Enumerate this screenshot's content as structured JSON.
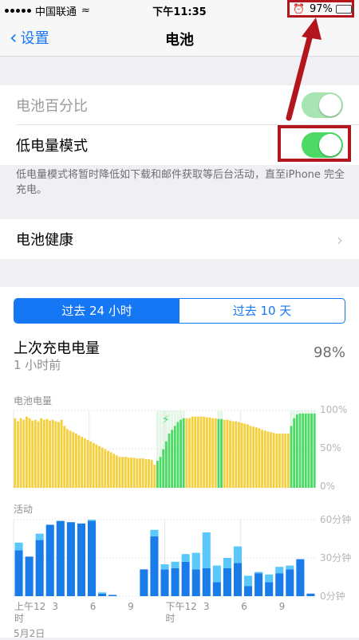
{
  "status_bar": {
    "carrier": "中国联通",
    "wifi": "≈",
    "time": "下午11:35",
    "battery_pct": "97%",
    "alarm": "⏰"
  },
  "nav": {
    "back": "设置",
    "title": "电池"
  },
  "settings": {
    "battery_percentage": "电池百分比",
    "low_power_mode": "低电量模式",
    "low_power_note": "低电量模式将暂时降低如下载和邮件获取等后台活动，直至iPhone 完全充电。",
    "battery_health": "电池健康"
  },
  "segment": {
    "left": "过去 24 小时",
    "right": "过去 10 天"
  },
  "last_charge": {
    "title": "上次充电电量",
    "time": "1 小时前",
    "value": "98%"
  },
  "chart_data": [
    {
      "type": "bar",
      "title": "电池电量",
      "y_ticks": [
        "100%",
        "50%",
        "0%"
      ],
      "ylim": [
        0,
        100
      ],
      "series": [
        {
          "values": [
            90,
            86,
            90,
            88,
            92,
            90,
            87,
            88,
            86,
            90,
            88,
            89,
            87,
            88,
            86,
            85,
            88,
            80,
            76,
            74,
            72,
            70,
            68,
            66,
            64,
            62,
            60,
            58,
            56,
            54,
            52,
            50,
            48,
            46,
            44,
            42,
            40,
            40,
            40,
            39,
            39,
            39,
            38,
            38,
            38,
            37,
            37,
            36,
            30,
            35,
            40,
            50,
            60,
            70,
            75,
            80,
            85,
            88,
            90,
            90,
            90,
            92,
            92,
            92,
            92,
            92,
            91,
            91,
            90,
            90,
            89,
            89,
            88,
            88,
            87,
            86,
            86,
            85,
            84,
            83,
            82,
            80,
            79,
            78,
            77,
            75,
            74,
            73,
            72,
            71,
            70,
            70,
            70,
            70,
            70,
            80,
            90,
            95,
            96,
            96,
            96,
            96,
            96,
            96
          ]
        }
      ],
      "bar_state": {
        "charging_index_ranges": [
          [
            49,
            58
          ],
          [
            70,
            71
          ],
          [
            95,
            103
          ]
        ],
        "yellow_index_ranges": [
          [
            0,
            48
          ],
          [
            59,
            69
          ],
          [
            72,
            94
          ]
        ]
      },
      "grid": true
    },
    {
      "type": "bar",
      "title": "活动",
      "y_ticks": [
        "60分钟",
        "30分钟",
        "0分钟"
      ],
      "ylim": [
        0,
        60
      ],
      "x_ticks": [
        "上午12\n时",
        "3",
        "6",
        "9",
        "下午12\n时",
        "3",
        "6",
        "9"
      ],
      "x_subtitle": "5月2日",
      "series": [
        {
          "name": "screen_on",
          "values": [
            36,
            31,
            44,
            56,
            59,
            58,
            57,
            59,
            2,
            1,
            0,
            0,
            21,
            47,
            21,
            22,
            27,
            21,
            22,
            11,
            22,
            26,
            8,
            18,
            11,
            18,
            21,
            29,
            2
          ]
        },
        {
          "name": "screen_off",
          "values": [
            6,
            0,
            5,
            0,
            0,
            0,
            0,
            1,
            1,
            0,
            0,
            0,
            0,
            5,
            4,
            5,
            6,
            13,
            28,
            13,
            8,
            13,
            8,
            1,
            6,
            5,
            3,
            0,
            0
          ]
        }
      ],
      "grid": true
    }
  ]
}
